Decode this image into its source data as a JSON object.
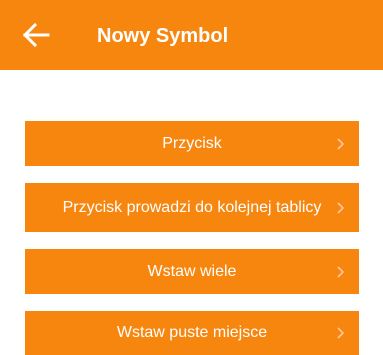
{
  "header": {
    "title": "Nowy Symbol",
    "back_icon": "arrow-left-icon",
    "background": "#f7860f",
    "text_color": "#ffffff"
  },
  "menu": {
    "items": [
      {
        "label": "Przycisk",
        "icon": "chevron-right-icon"
      },
      {
        "label": "Przycisk prowadzi do kolejnej tablicy",
        "icon": "chevron-right-icon"
      },
      {
        "label": "Wstaw wiele",
        "icon": "chevron-right-icon"
      },
      {
        "label": "Wstaw puste miejsce",
        "icon": "chevron-right-icon"
      }
    ],
    "button_color": "#f7860f",
    "chevron_color": "#ffc999"
  }
}
